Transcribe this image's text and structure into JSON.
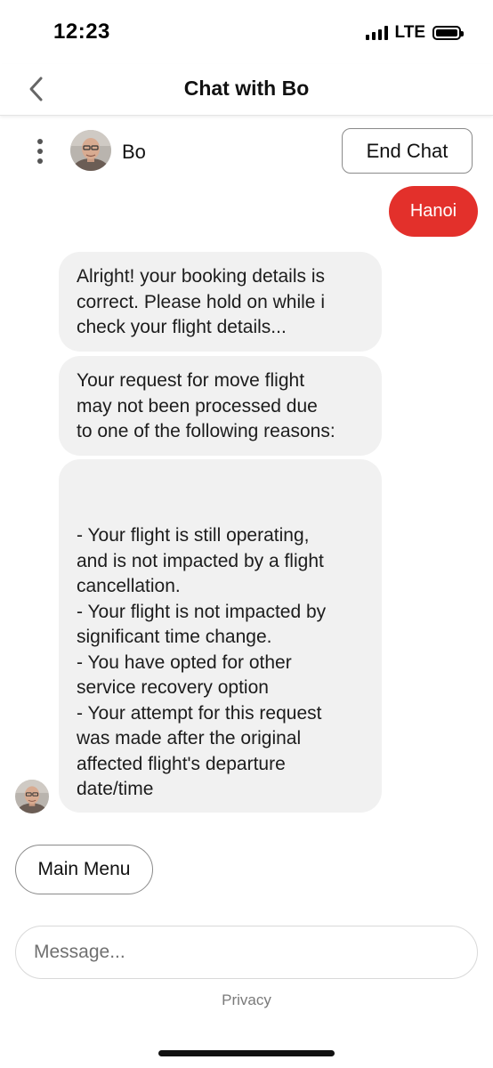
{
  "status_bar": {
    "time": "12:23",
    "network": "LTE"
  },
  "header": {
    "title": "Chat with Bo",
    "back_icon": "chevron-left-icon"
  },
  "agent": {
    "name": "Bo",
    "end_chat_label": "End Chat",
    "menu_icon": "kebab-menu-icon"
  },
  "messages": {
    "user": [
      "Hanoi"
    ],
    "bot": [
      "Alright! your booking details is\ncorrect. Please hold on while i\ncheck your flight details...",
      "Your request for move flight\nmay not been processed due\nto one of the following reasons:",
      "- Your flight is still operating,\nand is not impacted by a flight\ncancellation.\n- Your flight is not impacted by\nsignificant time change.\n- You have opted for other\nservice recovery option\n- Your attempt for this request\nwas made after the original\naffected flight's departure\ndate/time"
    ]
  },
  "quick_replies": [
    "Main Menu"
  ],
  "composer": {
    "placeholder": "Message...",
    "value": ""
  },
  "footer": {
    "privacy_label": "Privacy"
  },
  "colors": {
    "user_bubble": "#e3302b",
    "bot_bubble": "#f1f1f1",
    "border": "#8a8a8a"
  }
}
